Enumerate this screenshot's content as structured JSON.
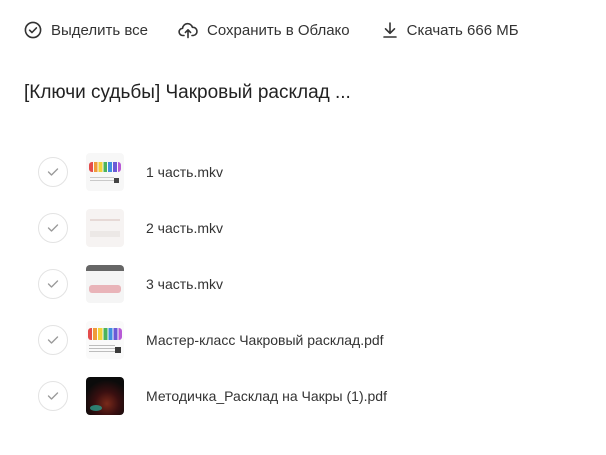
{
  "toolbar": {
    "select_all": "Выделить все",
    "save_to_cloud": "Сохранить в Облако",
    "download": "Скачать 666 МБ"
  },
  "folder": {
    "title": "[Ключи судьбы] Чакровый расклад ..."
  },
  "files": [
    {
      "name": "1 часть.mkv",
      "thumbnail": "chakra-dots",
      "selected": false
    },
    {
      "name": "2 часть.mkv",
      "thumbnail": "pale",
      "selected": false
    },
    {
      "name": "3 часть.mkv",
      "thumbnail": "pink",
      "selected": false
    },
    {
      "name": "Мастер-класс Чакровый расклад.pdf",
      "thumbnail": "chakra-pdf",
      "selected": false
    },
    {
      "name": "Методичка_Расклад на Чакры (1).pdf",
      "thumbnail": "dark",
      "selected": false
    }
  ],
  "colors": {
    "icon": "#333333",
    "check_border": "#e3e3e3",
    "check_mark": "#9a9a9a",
    "text": "#333333"
  }
}
